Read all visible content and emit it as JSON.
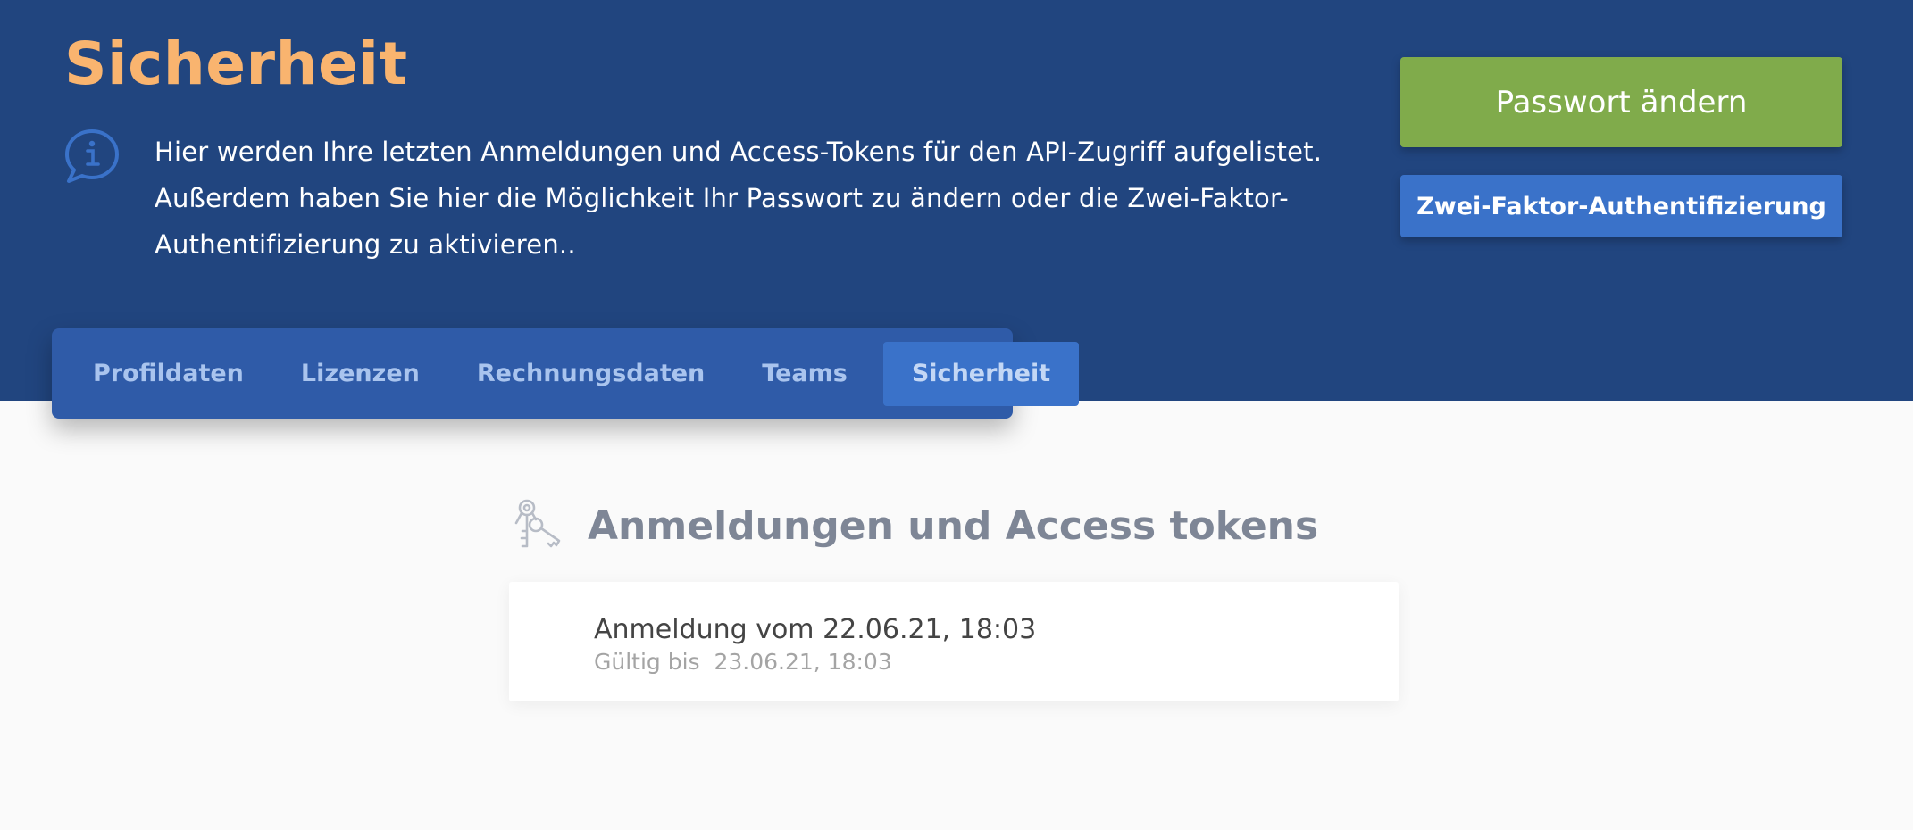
{
  "header": {
    "title": "Sicherheit",
    "intro": "Hier werden Ihre letzten Anmeldungen und Access-Tokens für den API-Zugriff aufgelistet. Außerdem haben Sie hier die Möglichkeit Ihr Passwort zu ändern oder die Zwei-Faktor-Authentifizierung zu aktivieren..",
    "info_icon": "info-speech-bubble-icon"
  },
  "actions": {
    "change_password_label": "Passwort ändern",
    "two_factor_label": "Zwei-Faktor-Authentifizierung"
  },
  "tabs": [
    {
      "label": "Profildaten",
      "active": false
    },
    {
      "label": "Lizenzen",
      "active": false
    },
    {
      "label": "Rechnungsdaten",
      "active": false
    },
    {
      "label": "Teams",
      "active": false
    },
    {
      "label": "Sicherheit",
      "active": true
    }
  ],
  "section": {
    "title": "Anmeldungen und Access tokens",
    "icon": "keys-icon",
    "items": [
      {
        "title": "Anmeldung vom 22.06.21, 18:03",
        "valid_until": "Gültig bis  23.06.21, 18:03"
      }
    ]
  },
  "colors": {
    "header_bg": "#21457f",
    "title_accent": "#f9b46f",
    "primary_green": "#80ab4b",
    "primary_blue": "#3a72c9",
    "tab_bar_bg": "#2f5ba8"
  }
}
